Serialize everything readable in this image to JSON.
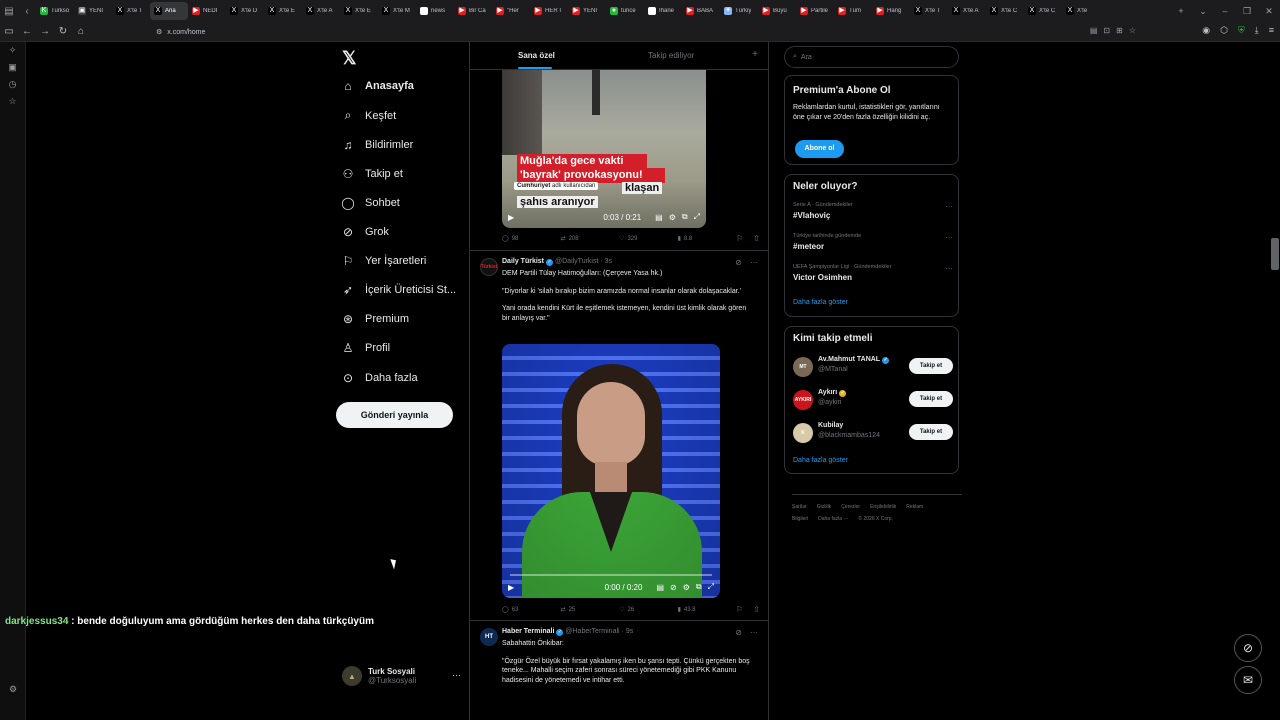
{
  "browser": {
    "tabs": [
      {
        "label": "Turkso",
        "color": "#1fba3b",
        "glyph": "K"
      },
      {
        "label": "YENİ",
        "color": "#444",
        "glyph": "▣"
      },
      {
        "label": "X'te T",
        "color": "#000",
        "glyph": "X"
      },
      {
        "label": "Ana",
        "color": "#000",
        "glyph": "X",
        "active": true
      },
      {
        "label": "NEDİ",
        "color": "#e02020",
        "glyph": "▶"
      },
      {
        "label": "X'te D",
        "color": "#000",
        "glyph": "X"
      },
      {
        "label": "X'te E",
        "color": "#000",
        "glyph": "X"
      },
      {
        "label": "X'te A",
        "color": "#000",
        "glyph": "X"
      },
      {
        "label": "X'te E",
        "color": "#000",
        "glyph": "X"
      },
      {
        "label": "X'te M",
        "color": "#000",
        "glyph": "X"
      },
      {
        "label": "news",
        "color": "#fff",
        "glyph": "G"
      },
      {
        "label": "Bir Ca",
        "color": "#e02020",
        "glyph": "▶"
      },
      {
        "label": "\"Her",
        "color": "#e02020",
        "glyph": "▶"
      },
      {
        "label": "HER İ",
        "color": "#e02020",
        "glyph": "▶"
      },
      {
        "label": "YENİ",
        "color": "#e02020",
        "glyph": "▶"
      },
      {
        "label": "tunce",
        "color": "#1fba3b",
        "glyph": "●"
      },
      {
        "label": "İhane",
        "color": "#fff",
        "glyph": "G"
      },
      {
        "label": "BABA",
        "color": "#e02020",
        "glyph": "▶"
      },
      {
        "label": "Türkiy",
        "color": "#8ab4f8",
        "glyph": "✦"
      },
      {
        "label": "Büyü",
        "color": "#e02020",
        "glyph": "▶"
      },
      {
        "label": "Partile",
        "color": "#e02020",
        "glyph": "▶"
      },
      {
        "label": "Tüm",
        "color": "#e02020",
        "glyph": "▶"
      },
      {
        "label": "Hang",
        "color": "#e02020",
        "glyph": "▶"
      },
      {
        "label": "X'te T",
        "color": "#000",
        "glyph": "X"
      },
      {
        "label": "X'te A",
        "color": "#000",
        "glyph": "X"
      },
      {
        "label": "X'te C",
        "color": "#000",
        "glyph": "X"
      },
      {
        "label": "X'te C",
        "color": "#000",
        "glyph": "X"
      },
      {
        "label": "X'te",
        "color": "#000",
        "glyph": "X"
      }
    ],
    "url": "x.com/home"
  },
  "nav": {
    "logo": "𝕏",
    "items": [
      {
        "label": "Anasayfa",
        "icon": "home-icon",
        "glyph": "⌂",
        "bold": true
      },
      {
        "label": "Keşfet",
        "icon": "search-icon",
        "glyph": "⌕"
      },
      {
        "label": "Bildirimler",
        "icon": "bell-icon",
        "glyph": "♫"
      },
      {
        "label": "Takip et",
        "icon": "person-plus-icon",
        "glyph": "⚇"
      },
      {
        "label": "Sohbet",
        "icon": "chat-icon",
        "glyph": "◯"
      },
      {
        "label": "Grok",
        "icon": "grok-icon",
        "glyph": "⊘"
      },
      {
        "label": "Yer İşaretleri",
        "icon": "bookmark-icon",
        "glyph": "⚐"
      },
      {
        "label": "İçerik Üreticisi St...",
        "icon": "rocket-icon",
        "glyph": "➶"
      },
      {
        "label": "Premium",
        "icon": "premium-icon",
        "glyph": "⊛"
      },
      {
        "label": "Profil",
        "icon": "profile-icon",
        "glyph": "♙"
      },
      {
        "label": "Daha fazla",
        "icon": "more-icon",
        "glyph": "⊙"
      }
    ],
    "post_button": "Gönderi yayınla",
    "account": {
      "name": "Turk Sosyali",
      "handle": "@Turksosyali"
    }
  },
  "chat": {
    "user": "darkjessus34",
    "message": " : bende doğuluyum ama gördüğüm herkes den daha türkçüyüm"
  },
  "timeline": {
    "tabs": [
      "Sana özel",
      "Takip ediliyor"
    ],
    "post1": {
      "caption_line1": "Muğla'da gece vakti",
      "caption_line2": "'bayrak' provokasyonu!",
      "source": "Cumhuriyet",
      "source_suffix": "adlı kullanıcıdan",
      "sub_line1": "klaşan",
      "sub_line2": "şahıs aranıyor",
      "time": "0:03 / 0:21",
      "replies": "98",
      "reposts": "208",
      "likes": "329",
      "views": "8.8"
    },
    "post2": {
      "name": "Daily Türkist",
      "handle": "@DailyTurkist",
      "time": "3s",
      "avatar_text": "Türkist",
      "line1": "DEM Partili Tülay Hatimoğulları: (Çerçeve Yasa hk.)",
      "line2": "\"Diyorlar ki 'silah bırakıp bizim aramızda normal insanlar olarak dolaşacaklar.'",
      "line3": "Yani orada kendini Kürt ile eşitlemek istemeyen, kendini üst kimlik olarak gören bir anlayış var.\"",
      "video_time": "0:00 / 0:20",
      "replies": "63",
      "reposts": "25",
      "likes": "26",
      "views": "43.8"
    },
    "post3": {
      "name": "Haber Terminali",
      "handle": "@HaberTerminali",
      "time": "9s",
      "avatar_text": "HT",
      "line1": "Sabahattin Önkibar:",
      "line2": "\"Özgür Özel büyük bir fırsat yakalamış iken bu şansı tepti. Çünkü gerçekten boş teneke... Mahalli seçim zaferi sonrası süreci yönetemediği gibi PKK Kanunu hadisesini de yönetemedi ve intihar etti."
    }
  },
  "right": {
    "search_placeholder": "Ara",
    "premium": {
      "title": "Premium'a Abone Ol",
      "text": "Reklamlardan kurtul, istatistikleri gör, yanıtlarını öne çıkar ve 20'den fazla özelliğin kilidini aç.",
      "button": "Abone ol"
    },
    "trends": {
      "title": "Neler oluyor?",
      "items": [
        {
          "context": "Serie A · Gündemdekiler",
          "topic": "#Vlahoviç"
        },
        {
          "context": "Türkiye tarihinde gündemde",
          "topic": "#meteor"
        },
        {
          "context": "UEFA Şampiyonlar Ligi · Gündemdekiler",
          "topic": "Victor Osimhen"
        }
      ],
      "more": "Daha fazla göster"
    },
    "who": {
      "title": "Kimi takip etmeli",
      "items": [
        {
          "name": "Av.Mahmut TANAL",
          "handle": "@MTanal",
          "verified": "blue",
          "avatar": "MT",
          "avcolor": "#7a6a55"
        },
        {
          "name": "Aykırı",
          "handle": "@aykiri",
          "verified": "gold",
          "avatar": "AYKIRI",
          "avcolor": "#c9151b"
        },
        {
          "name": "Kubilay",
          "handle": "@blackmambas124",
          "verified": "",
          "avatar": "K",
          "avcolor": "#d8c9a8"
        }
      ],
      "button": "Takip et",
      "more": "Daha fazla göster"
    },
    "footer": [
      "Şartlar",
      "Gizlilik",
      "Çerezler",
      "Erişilebilirlik",
      "Reklam Bilgileri",
      "Daha fazla ···",
      "© 2026 X Corp."
    ]
  }
}
